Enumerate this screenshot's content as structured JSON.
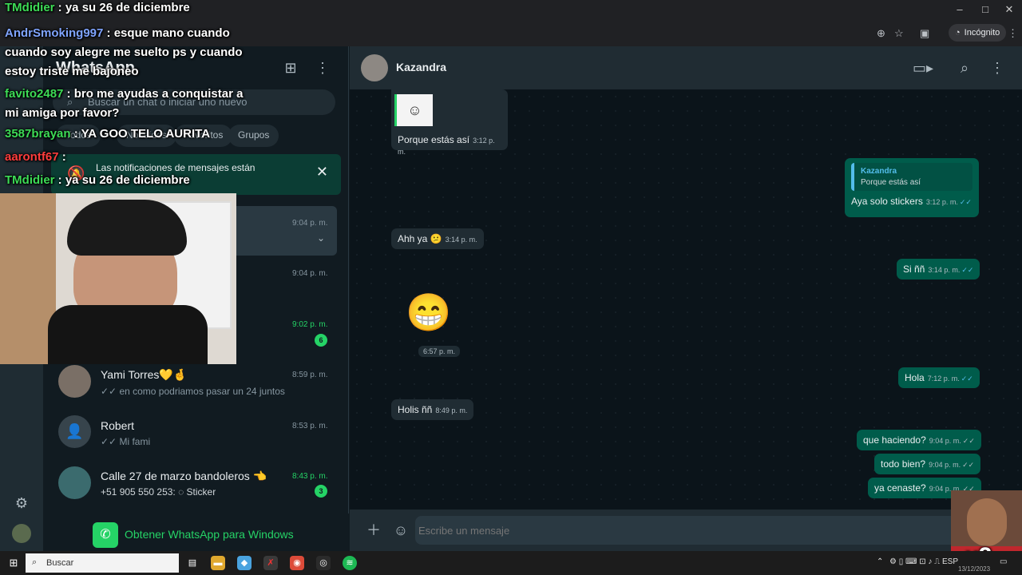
{
  "browser": {
    "incognito_label": "Incógnito",
    "minimize": "–",
    "maximize": "□",
    "close": "✕"
  },
  "left": {
    "title": "WhatsApp",
    "search_placeholder": "Buscar un chat o iniciar uno nuevo",
    "chips": [
      "Todos",
      "No leídos",
      "Favoritos",
      "Grupos"
    ],
    "notification": "Las notificaciones de mensajes están",
    "chats": [
      {
        "name": "",
        "preview": "",
        "time": "9:04 p. m.",
        "badge": ""
      },
      {
        "name": "",
        "preview": "",
        "time": "9:04 p. m.",
        "badge": ""
      },
      {
        "name": "",
        "preview": "",
        "time": "9:02 p. m.",
        "badge": "6"
      },
      {
        "name": "Yami Torres💛🤞",
        "preview": "✓✓ en como podriamos pasar un 24 juntos",
        "time": "8:59 p. m.",
        "badge": ""
      },
      {
        "name": "Robert",
        "preview": "✓✓ Mi fami",
        "time": "8:53 p. m.",
        "badge": ""
      },
      {
        "name": "Calle 27 de marzo bandoleros 👈",
        "preview": "+51 905 550 253: ◌ Sticker",
        "time": "8:43 p. m.",
        "badge": "3"
      }
    ],
    "get_windows": "Obtener WhatsApp para Windows"
  },
  "chat": {
    "contact": "Kazandra",
    "messages": [
      {
        "dir": "in",
        "text": "Porque estás así",
        "time": "3:12 p. m."
      },
      {
        "dir": "out",
        "quote_name": "Kazandra",
        "quote_text": "Porque estás así",
        "text": "Aya solo stickers",
        "time": "3:12 p. m."
      },
      {
        "dir": "in",
        "text": "Ahh ya 😕",
        "time": "3:14 p. m."
      },
      {
        "dir": "out",
        "text": "Si ññ",
        "time": "3:14 p. m."
      },
      {
        "dir": "in",
        "text": "😁",
        "time": "6:57 p. m."
      },
      {
        "dir": "out",
        "text": "Hola",
        "time": "7:12 p. m."
      },
      {
        "dir": "in",
        "text": "Holis ññ",
        "time": "8:49 p. m."
      },
      {
        "dir": "out",
        "text": "que haciendo?",
        "time": "9:04 p. m."
      },
      {
        "dir": "out",
        "text": "todo bien?",
        "time": "9:04 p. m."
      },
      {
        "dir": "out",
        "text": "ya cenaste?",
        "time": "9:04 p. m."
      }
    ],
    "composer_placeholder": "Escribe un mensaje"
  },
  "stream_chat": [
    {
      "user": "TMdidier",
      "msg": "ya su 26 de diciembre",
      "color": "green"
    },
    {
      "user": "AndrSmoking997",
      "msg": "esque mano cuando cuando soy alegre me suelto ps y cuando estoy triste me bajoneo",
      "color": "blue"
    },
    {
      "user": "favito2487",
      "msg": "bro me ayudas a conquistar a mi amiga por favor?",
      "color": "green"
    },
    {
      "user": "3587brayan",
      "msg": "YA GOO TELO AURITA",
      "color": "green"
    },
    {
      "user": "aarontf67",
      "msg": "",
      "color": "red"
    },
    {
      "user": "TMdidier",
      "msg": "ya su 26 de diciembre",
      "color": "green"
    }
  ],
  "cam_badge": "x2",
  "taskbar": {
    "search": "Buscar",
    "lang": "ESP",
    "date": "13/12/2023"
  },
  "colors": {
    "accent": "#25d366",
    "outgoing": "#005c4b",
    "incoming": "#202c33"
  }
}
